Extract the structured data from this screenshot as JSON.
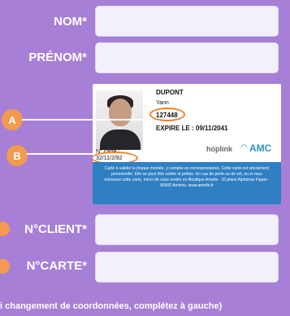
{
  "form": {
    "nom_label": "NOM*",
    "prenom_label": "PRÉNOM*",
    "client_label": "N°CLIENT*",
    "carte_label": "N°CARTE*",
    "footnote": "i changement de coordonnées, complétez à gauche)"
  },
  "card": {
    "last_name": "DUPONT",
    "first_name": "Yann",
    "client_number": "127448",
    "expiry": "EXPIRE LE : 09/11/2041",
    "card_number_label": "N° carte :",
    "card_number": "32/11/2/92",
    "brand_left": "hoplink",
    "brand_right": "AMC",
    "band_text": "Carte à valider à chaque montée, y compris en correspondance. Cette carte est strictement personnelle. Elle ne peut être cédée ni prêtée. En cas de perte ou de vol, ou si vous retrouvez cette carte, merci de vous rendre en Boutique Ametis - 10 place Alphonse Fiquet - 80000 Amiens. www.ametis.fr"
  },
  "callouts": {
    "a": "A",
    "b": "B"
  },
  "colors": {
    "background": "#a77fd6",
    "field": "#f2f1fb",
    "callout": "#f39a4f",
    "card_band": "#2f7fc3"
  }
}
